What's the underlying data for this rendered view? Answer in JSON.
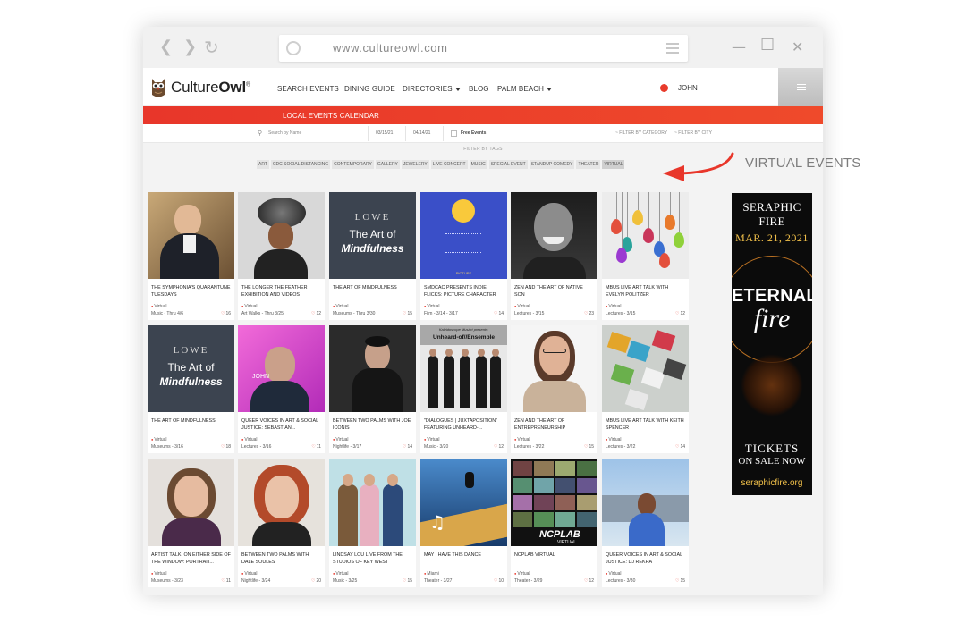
{
  "browser": {
    "url": "www.cultureowl.com",
    "back_glyph": "❮",
    "forward_glyph": "❯",
    "reload_glyph": "↻",
    "minimize_glyph": "—",
    "maximize_glyph": "☐",
    "close_glyph": "✕"
  },
  "site": {
    "logo_prefix": "Culture",
    "logo_suffix": "Owl",
    "logo_mark": "®",
    "nav": [
      "SEARCH EVENTS",
      "DINING GUIDE",
      "DIRECTORIES",
      "BLOG",
      "PALM BEACH"
    ],
    "user_name": "JOHN",
    "section_title": "LOCAL EVENTS CALENDAR"
  },
  "search": {
    "placeholder": "Search by Name",
    "date_from": "03/15/21",
    "date_to": "04/14/21",
    "free_label": "Free Events",
    "filter_category": "~ FILTER BY CATEGORY",
    "filter_city": "~ FILTER BY CITY"
  },
  "tags": {
    "label": "FILTER BY TAGS",
    "items": [
      "ART",
      "CDC SOCIAL DISTANCING",
      "CONTEMPORARY",
      "GALLERY",
      "JEWELERY",
      "LIVE CONCERT",
      "MUSIC",
      "SPECIAL EVENT",
      "STANDUP COMEDY",
      "THEATER",
      "VIRTUAL"
    ],
    "active": "VIRTUAL"
  },
  "annotation": {
    "text": "VIRTUAL EVENTS"
  },
  "cards": [
    {
      "title": "The Symphonia's Quarantune Tuesdays",
      "location": "Virtual",
      "category": "Music - Thru 4/6",
      "likes": "16",
      "img": "symph"
    },
    {
      "title": "The Longer the Feather Exhibition and Videos",
      "location": "Virtual",
      "category": "Art Walks - Thru 3/25",
      "likes": "12",
      "img": "feather"
    },
    {
      "title": "The Art of Mindfulness",
      "location": "Virtual",
      "category": "Museums - Thru 3/30",
      "likes": "15",
      "img": "lowe"
    },
    {
      "title": "SMDCAC Presents Indie Flicks: Picture Character",
      "location": "Virtual",
      "category": "Film - 3/14 - 3/17",
      "likes": "14",
      "img": "emoji"
    },
    {
      "title": "Zen and the Art of Native Son",
      "location": "Virtual",
      "category": "Lectures - 3/15",
      "likes": "23",
      "img": "zen"
    },
    {
      "title": "MBUS Live Art Talk with Evelyn Politzer",
      "location": "Virtual",
      "category": "Lectures - 3/15",
      "likes": "12",
      "img": "eggs"
    },
    {
      "title": "The Art of Mindfulness",
      "location": "Virtual",
      "category": "Museums - 3/16",
      "likes": "18",
      "img": "lowe"
    },
    {
      "title": "Queer Voices in Art & Social Justice: Sebastian...",
      "location": "Virtual",
      "category": "Lectures - 3/16",
      "likes": "11",
      "img": "queer1"
    },
    {
      "title": "Between Two Palms with Joe Iconis",
      "location": "Virtual",
      "category": "Nightlife - 3/17",
      "likes": "14",
      "img": "joe"
    },
    {
      "title": "\"Dialogues | Juxtaposition\" featuring Unheard-...",
      "location": "Virtual",
      "category": "Music - 3/20",
      "likes": "12",
      "img": "ensemble"
    },
    {
      "title": "Zen and the Art of Entrepreneurship",
      "location": "Virtual",
      "category": "Lectures - 3/22",
      "likes": "15",
      "img": "zen2"
    },
    {
      "title": "MBUS Live Art Talk with Keith Spencer",
      "location": "Virtual",
      "category": "Lectures - 3/22",
      "likes": "14",
      "img": "keith"
    },
    {
      "title": "Artist Talk: On Either Side of the Window: Portrait...",
      "location": "Virtual",
      "category": "Museums - 3/23",
      "likes": "11",
      "img": "artist"
    },
    {
      "title": "Between Two Palms with Dale Soules",
      "location": "Virtual",
      "category": "Nightlife - 3/24",
      "likes": "20",
      "img": "dale"
    },
    {
      "title": "Lindsay Lou Live from the Studios of Key West",
      "location": "Virtual",
      "category": "Music - 3/25",
      "likes": "15",
      "img": "lindsay"
    },
    {
      "title": "May I Have This Dance",
      "location": "Miami",
      "category": "Theater - 3/27",
      "likes": "10",
      "img": "dance"
    },
    {
      "title": "NCPLab Virtual",
      "location": "Virtual",
      "category": "Theater - 3/29",
      "likes": "12",
      "img": "ncp"
    },
    {
      "title": "Queer Voices in Art & Social Justice: DJ Rekha",
      "location": "Virtual",
      "category": "Lectures - 3/30",
      "likes": "15",
      "img": "rekha"
    }
  ],
  "card_images": {
    "lowe_top": "LOWE",
    "lowe_main": "The Art of",
    "lowe_sub": "Mindfulness",
    "emoji_caption": "PICTURE",
    "ensemble_top": "Kaleidoscope MusArt presents:",
    "ensemble_main": "Unheard-of//Ensemble",
    "queer_name": "JOHN",
    "ncp_text": "NCPLAB",
    "ncp_sub": "VIRTUAL"
  },
  "ad": {
    "brand": "SERAPHIC FIRE",
    "date": "MAR. 21, 2021",
    "title1": "ETERNAL",
    "title2": "fire",
    "tickets": "TICKETS",
    "sale": "ON SALE NOW",
    "url": "seraphicfire.org"
  }
}
